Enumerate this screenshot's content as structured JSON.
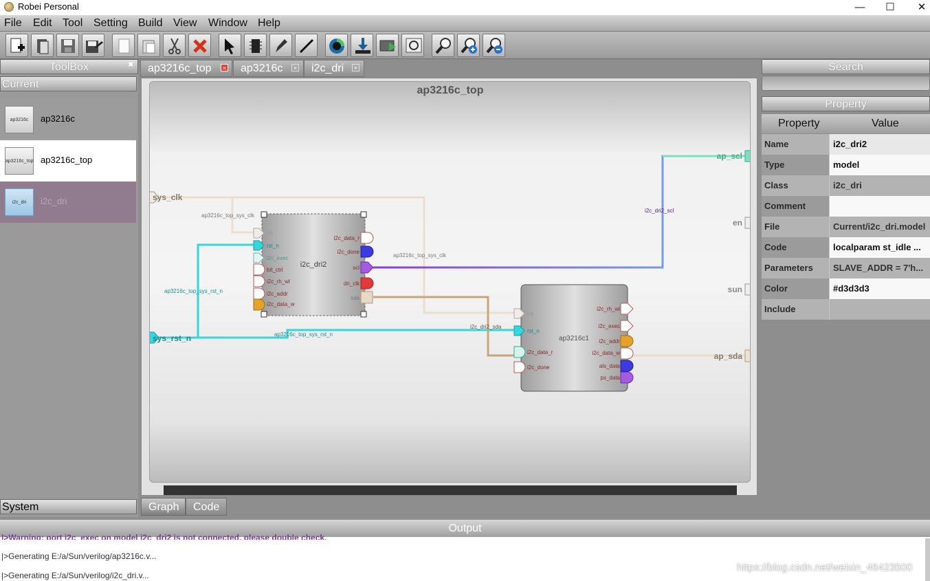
{
  "window": {
    "title": "Robei  Personal"
  },
  "menu": [
    "File",
    "Edit",
    "Tool",
    "Setting",
    "Build",
    "View",
    "Window",
    "Help"
  ],
  "toolbar": [
    "new-icon",
    "open-icon",
    "save-icon",
    "save-all-icon",
    "copy-icon",
    "paste-icon",
    "cut-icon",
    "delete-icon",
    "select-icon",
    "module-icon",
    "pen-icon",
    "wire-icon",
    "run-icon",
    "download-icon",
    "simulate-icon",
    "zoom-fit-icon",
    "zoom-icon",
    "zoom-in-icon",
    "zoom-out-icon"
  ],
  "toolbox": {
    "title": "ToolBox",
    "current_label": "Current",
    "system_label": "System",
    "items": [
      {
        "label": "ap3216c",
        "thumb": "ap3216c"
      },
      {
        "label": "ap3216c_top",
        "thumb": "ap3216c_top"
      },
      {
        "label": "i2c_dri",
        "thumb": "i2c_dri"
      }
    ]
  },
  "tabs": [
    {
      "label": "ap3216c_top",
      "close": "×"
    },
    {
      "label": "ap3216c",
      "close": "×"
    },
    {
      "label": "i2c_dri",
      "close": "×"
    }
  ],
  "bottom_tabs": [
    "Graph",
    "Code"
  ],
  "diagram": {
    "title": "ap3216c_top",
    "top_ports_in": [
      "sys_clk",
      "sys_rst_n"
    ],
    "top_ports_out": [
      "ap_scl",
      "en",
      "sun",
      "ap_sda"
    ],
    "module1": {
      "name": "i2c_dri2",
      "inputs": [
        "clk",
        "rst_n",
        "i2c_exec",
        "bit_ctrl",
        "i2c_rh_wl",
        "i2c_addr",
        "i2c_data_w"
      ],
      "outputs": [
        "i2c_data_r",
        "i2c_done",
        "scl",
        "dri_clk",
        "sda"
      ]
    },
    "module2": {
      "name": "ap3216c1",
      "inputs": [
        "clk",
        "rst_n",
        "i2c_data_r",
        "i2c_done"
      ],
      "outputs": [
        "i2c_rh_wl",
        "i2c_exec",
        "i2c_addr",
        "i2c_data_w",
        "als_data",
        "ps_data"
      ]
    },
    "wire_labels": [
      "ap3216c_top_sys_clk",
      "ap3216c_top_sys_clk",
      "ap3216c_top_sys_rst_n",
      "ap3216c_top_sys_rst_n",
      "i2c_dri2_scl",
      "i2c_dri2_sda"
    ]
  },
  "search": {
    "title": "Search",
    "value": ""
  },
  "property": {
    "title": "Property",
    "col_property": "Property",
    "col_value": "Value",
    "rows": [
      {
        "key": "Name",
        "value": "i2c_dri2"
      },
      {
        "key": "Type",
        "value": "model"
      },
      {
        "key": "Class",
        "value": "i2c_dri"
      },
      {
        "key": "Comment",
        "value": ""
      },
      {
        "key": "File",
        "value": "Current/i2c_dri.model"
      },
      {
        "key": "Code",
        "value": "localparam  st_idle  ..."
      },
      {
        "key": "Parameters",
        "value": " SLAVE_ADDR =  7'h..."
      },
      {
        "key": "Color",
        "value": "#d3d3d3"
      },
      {
        "key": "Include",
        "value": ""
      }
    ]
  },
  "output": {
    "title": "Output",
    "lines": [
      "|>Warning: port i2c_exec on model i2c_dri2 is not connected, please double check.",
      "|>Generating E:/a/Sun/verilog/ap3216c.v...",
      "|>Generating E:/a/Sun/verilog/i2c_dri.v..."
    ]
  },
  "watermark": "https://blog.csdn.net/weixin_46423500",
  "colors": {
    "accent_cyan": "#35d6dc",
    "wire_purple": "#8a3be0",
    "wire_tan": "#c9a57a",
    "wire_mint": "#7fe0c0"
  }
}
